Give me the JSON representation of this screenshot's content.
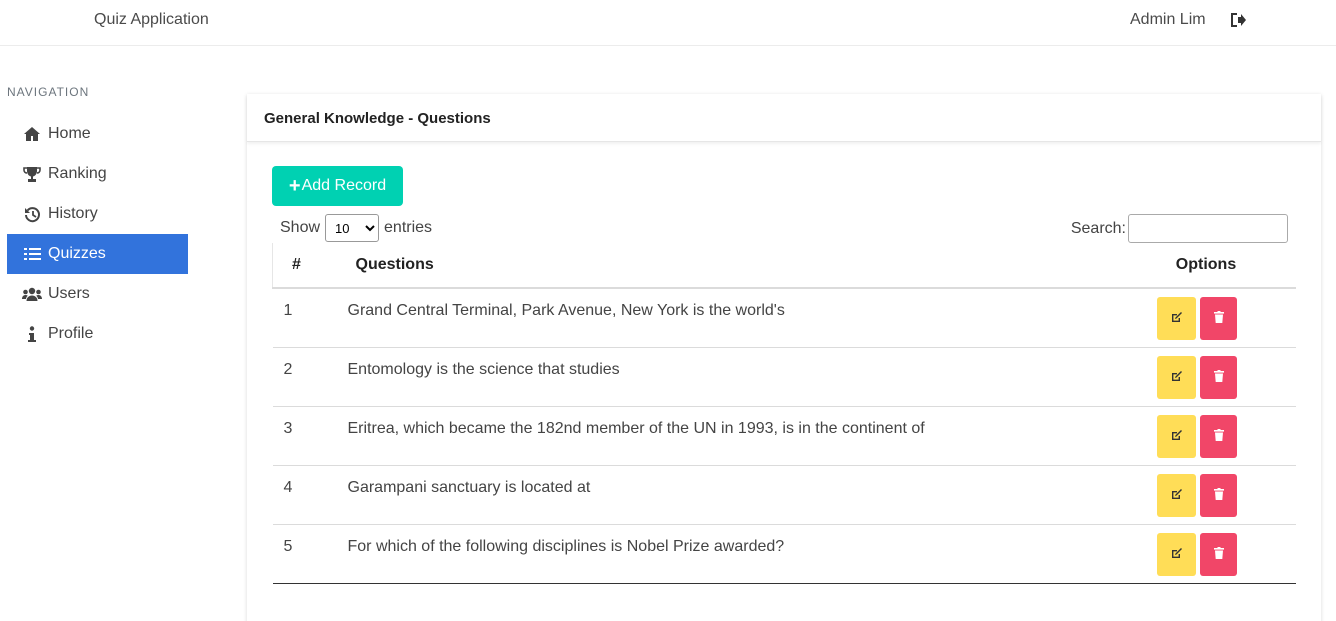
{
  "header": {
    "app_title": "Quiz Application",
    "user_name": "Admin Lim",
    "logout_icon": "sign-out-icon"
  },
  "sidebar": {
    "heading": "NAVIGATION",
    "active_color": "#3273dc",
    "items": [
      {
        "label": "Home",
        "icon": "home-icon"
      },
      {
        "label": "Ranking",
        "icon": "trophy-icon"
      },
      {
        "label": "History",
        "icon": "history-icon"
      },
      {
        "label": "Quizzes",
        "icon": "list-icon",
        "active": true
      },
      {
        "label": "Users",
        "icon": "users-icon"
      },
      {
        "label": "Profile",
        "icon": "info-icon"
      }
    ]
  },
  "card": {
    "title": "General Knowledge - Questions",
    "add_label": "Add Record",
    "show_label": "Show",
    "entries_label": "entries",
    "page_size": "10",
    "search_label": "Search:",
    "search_value": "",
    "columns": [
      "#",
      "Questions",
      "Options"
    ],
    "rows": [
      {
        "num": "1",
        "question": "Grand Central Terminal, Park Avenue, New York is the world's"
      },
      {
        "num": "2",
        "question": "Entomology is the science that studies"
      },
      {
        "num": "3",
        "question": "Eritrea, which became the 182nd member of the UN in 1993, is in the continent of"
      },
      {
        "num": "4",
        "question": "Garampani sanctuary is located at"
      },
      {
        "num": "5",
        "question": "For which of the following disciplines is Nobel Prize awarded?"
      }
    ]
  },
  "colors": {
    "add_button": "#00d1b2",
    "edit_button": "#ffdd57",
    "delete_button": "#f14668"
  }
}
